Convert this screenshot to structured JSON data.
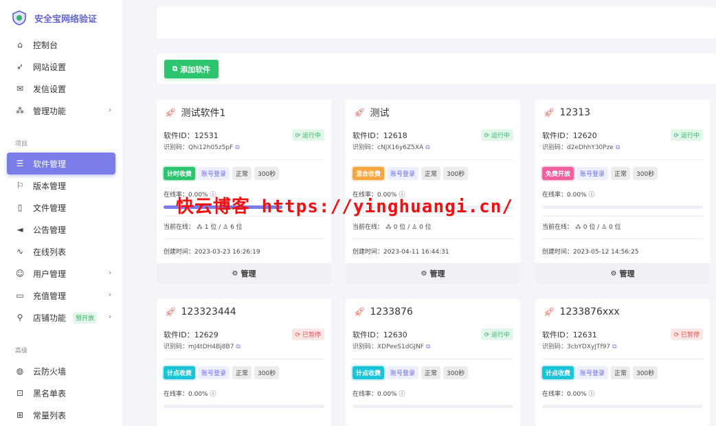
{
  "brand": {
    "title": "安全宝网络验证"
  },
  "nav": {
    "items": [
      {
        "label": "控制台",
        "icon": "home-icon"
      },
      {
        "label": "网站设置",
        "icon": "rocket-icon"
      },
      {
        "label": "发信设置",
        "icon": "mail-icon"
      },
      {
        "label": "管理功能",
        "icon": "apps-icon",
        "chevron": true
      }
    ],
    "section_project": "项目",
    "project_items": [
      {
        "label": "软件管理",
        "icon": "server-icon",
        "active": true
      },
      {
        "label": "版本管理",
        "icon": "bookmark-icon"
      },
      {
        "label": "文件管理",
        "icon": "file-icon"
      },
      {
        "label": "公告管理",
        "icon": "megaphone-icon"
      },
      {
        "label": "在线列表",
        "icon": "pulse-icon"
      },
      {
        "label": "用户管理",
        "icon": "users-icon",
        "chevron": true
      },
      {
        "label": "充值管理",
        "icon": "card-icon",
        "chevron": true
      },
      {
        "label": "店铺功能",
        "icon": "pin-icon",
        "chevron": true,
        "tag": "预开放"
      }
    ],
    "section_advanced": "高级",
    "advanced_items": [
      {
        "label": "云防火墙",
        "icon": "globe-icon"
      },
      {
        "label": "黑名单表",
        "icon": "lock-icon"
      },
      {
        "label": "常量列表",
        "icon": "table-icon"
      }
    ]
  },
  "toolbar": {
    "add_label": "添加软件"
  },
  "labels": {
    "id": "软件ID：",
    "code": "识别码：",
    "online_rate": "在线率：",
    "current_online": "当前在线：",
    "created": "创建时间：",
    "manage": "管理",
    "account_login": "账号登录",
    "normal": "正常",
    "duration": "300秒"
  },
  "cards": [
    {
      "name": "测试软件1",
      "id": "12531",
      "status": "运行中",
      "status_type": "run",
      "code": "Qhi12h05z5pF",
      "mode": "计时收费",
      "mode_color": "green",
      "online_rate": "0.00%",
      "online_rate_value": 0.74,
      "online_a": "1 位",
      "online_b": "6 位",
      "created": "2023-03-23 16:26:19"
    },
    {
      "name": "测试",
      "id": "12618",
      "status": "运行中",
      "status_type": "run",
      "code": "cNJX16y6Z5XA",
      "mode": "混合收费",
      "mode_color": "orange",
      "online_rate": "0.00%",
      "online_rate_value": 0,
      "online_a": "0 位",
      "online_b": "0 位",
      "created": "2023-04-11 16:44:31"
    },
    {
      "name": "12313",
      "id": "12620",
      "status": "运行中",
      "status_type": "run",
      "code": "d2eDhhY30Pze",
      "mode": "免费开放",
      "mode_color": "pink",
      "online_rate": "0.00%",
      "online_rate_value": 0,
      "online_a": "0 位",
      "online_b": "0 位",
      "created": "2023-05-12 14:56:25"
    },
    {
      "name": "123323444",
      "id": "12629",
      "status": "已暂停",
      "status_type": "stop",
      "code": "mJ4tDH4Bj8B7",
      "mode": "计点收费",
      "mode_color": "cyan",
      "online_rate": "0.00%",
      "online_rate_value": 0
    },
    {
      "name": "1233876",
      "id": "12630",
      "status": "运行中",
      "status_type": "run",
      "code": "XDPeeS1dGJNF",
      "mode": "计点收费",
      "mode_color": "cyan",
      "online_rate": "0.00%",
      "online_rate_value": 0
    },
    {
      "name": "1233876xxx",
      "id": "12631",
      "status": "已暂停",
      "status_type": "stop",
      "code": "3cbYDXyJTf97",
      "mode": "计点收费",
      "mode_color": "cyan",
      "online_rate": "0.00%",
      "online_rate_value": 0
    }
  ],
  "watermark": "快云博客 https://yinghuangi.cn/"
}
